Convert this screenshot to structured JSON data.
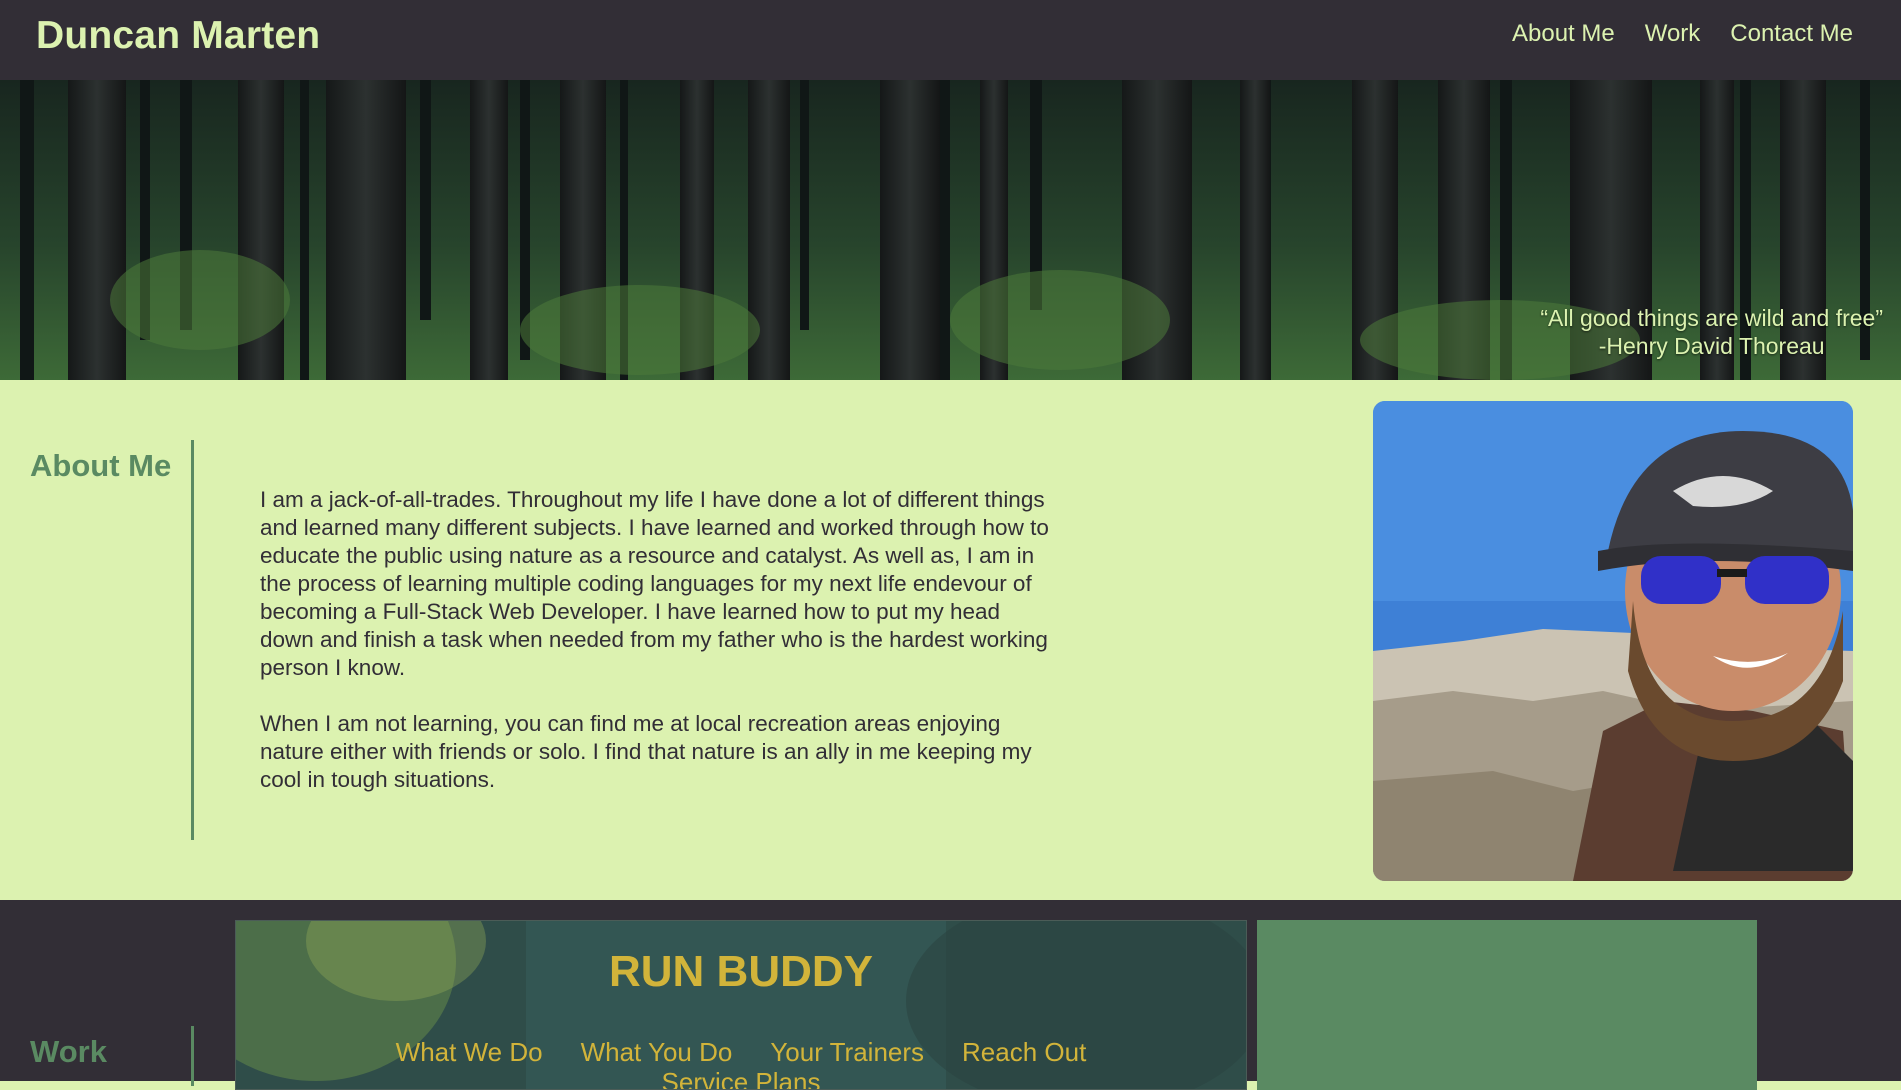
{
  "header": {
    "name": "Duncan Marten",
    "nav": [
      {
        "label": "About Me"
      },
      {
        "label": "Work"
      },
      {
        "label": "Contact Me"
      }
    ]
  },
  "hero": {
    "quote": "“All good things are wild and free”",
    "author": "-Henry David Thoreau"
  },
  "about": {
    "heading": "About Me",
    "paragraph1": "I am a jack-of-all-trades. Throughout my life I have done a lot of different things and learned many different subjects. I have learned and worked through how to educate the public using nature as a resource and catalyst. As well as, I am in the process of learning multiple coding languages for my next life endevour of becoming a Full-Stack Web Developer. I have learned how to put my head down and finish a task when needed from my father who is the hardest working person I know.",
    "paragraph2": "When I am not learning, you can find me at local recreation areas enjoying nature either with friends or solo. I find that nature is an ally in me keeping my cool in tough situations."
  },
  "work": {
    "heading": "Work",
    "project": {
      "title": "RUN BUDDY",
      "nav": [
        "What We Do",
        "What You Do",
        "Your Trainers",
        "Reach Out"
      ],
      "nav_overflow": "Service Plans"
    }
  },
  "colors": {
    "header_bg": "#322e36",
    "accent_light": "#dcf2b0",
    "accent_green": "#5a8a62",
    "project_text": "#d2b43a"
  }
}
